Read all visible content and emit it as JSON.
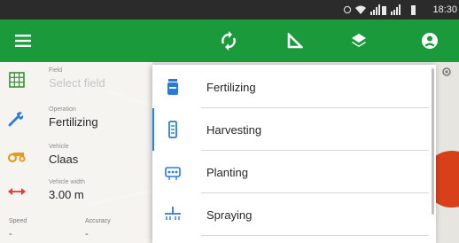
{
  "statusbar": {
    "time": "18:30"
  },
  "toolbar": {
    "menu_icon": "hamburger-menu-icon",
    "sync_icon": "sync-icon",
    "measure_icon": "measure-triangle-icon",
    "layers_icon": "layers-icon",
    "account_icon": "account-circle-icon"
  },
  "left_panel": {
    "rows": [
      {
        "small": "Field",
        "value": "Select field",
        "icon": "field-grid-icon"
      },
      {
        "small": "Operation",
        "value": "Fertilizing",
        "icon": "wrench-icon"
      },
      {
        "small": "Vehicle",
        "value": "Claas",
        "icon": "tractor-icon"
      },
      {
        "small": "Vehicle width",
        "value": "3.00 m",
        "icon": "width-arrow-icon"
      }
    ],
    "bottom": [
      {
        "label": "Speed",
        "value": "-"
      },
      {
        "label": "Accuracy",
        "value": "-"
      }
    ]
  },
  "dropdown": {
    "items": [
      {
        "label": "Fertilizing",
        "icon": "fertilizer-icon"
      },
      {
        "label": "Harvesting",
        "icon": "harvest-icon"
      },
      {
        "label": "Planting",
        "icon": "planting-icon"
      },
      {
        "label": "Spraying",
        "icon": "spraying-icon"
      }
    ]
  },
  "colors": {
    "toolbar": "#1b9a3b",
    "accent": "#1e88e5",
    "fab": "#d8401a"
  }
}
